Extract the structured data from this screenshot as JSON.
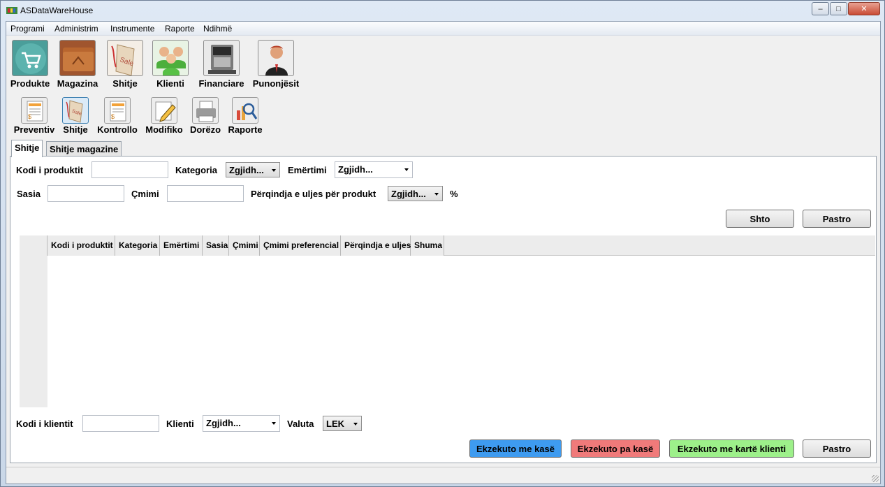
{
  "window": {
    "title": "ASDataWareHouse",
    "close_glyph": "✕",
    "minimize_glyph": "–",
    "maximize_glyph": "□"
  },
  "menu": [
    "Programi",
    "Administrim",
    "Instrumente",
    "Raporte",
    "Ndihmë"
  ],
  "main_toolbar": [
    {
      "label": "Produkte",
      "icon": "shopping-cart-icon"
    },
    {
      "label": "Magazina",
      "icon": "warehouse-folder-icon"
    },
    {
      "label": "Shitje",
      "icon": "sale-tag-icon"
    },
    {
      "label": "Klienti",
      "icon": "customers-icon"
    },
    {
      "label": "Financiare",
      "icon": "cash-register-icon"
    },
    {
      "label": "Punonjësit",
      "icon": "employee-icon"
    }
  ],
  "sub_toolbar": [
    {
      "label": "Preventiv",
      "icon": "invoice-icon"
    },
    {
      "label": "Shitje",
      "icon": "sale-tag-icon"
    },
    {
      "label": "Kontrollo",
      "icon": "invoice-check-icon"
    },
    {
      "label": "Modifiko",
      "icon": "pencil-edit-icon"
    },
    {
      "label": "Dorëzo",
      "icon": "printer-icon"
    },
    {
      "label": "Raporte",
      "icon": "chart-magnifier-icon"
    }
  ],
  "tabs": [
    "Shitje",
    "Shitje magazine"
  ],
  "form": {
    "product_code_label": "Kodi i produktit",
    "category_label": "Kategoria",
    "category_value": "Zgjidh...",
    "name_label": "Emërtimi",
    "name_value": "Zgjidh...",
    "quantity_label": "Sasia",
    "price_label": "Çmimi",
    "discount_label": "Përqindja e uljes për produkt",
    "discount_value": "Zgjidh...",
    "percent_sign": "%",
    "add_button": "Shto",
    "clear_button": "Pastro"
  },
  "grid": {
    "columns": [
      "Kodi i produktit",
      "Kategoria",
      "Emërtimi",
      "Sasia",
      "Çmimi",
      "Çmimi preferencial",
      "Përqindja e uljes",
      "Shuma"
    ]
  },
  "footer": {
    "client_code_label": "Kodi i klientit",
    "client_label": "Klienti",
    "client_value": "Zgjidh...",
    "currency_label": "Valuta",
    "currency_value": "LEK",
    "exec_cash_button": "Ekzekuto me kasë",
    "exec_nocash_button": "Ekzekuto pa kasë",
    "exec_card_button": "Ekzekuto me kartë klienti",
    "clear_button": "Pastro"
  },
  "colors": {
    "exec_cash": "#3e9bf0",
    "exec_nocash": "#f07a7a",
    "exec_card": "#9df08a"
  }
}
